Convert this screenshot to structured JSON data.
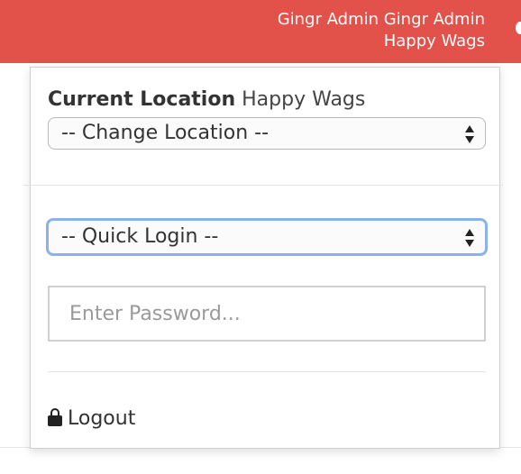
{
  "header": {
    "user_name": "Gingr Admin Gingr Admin",
    "location_name": "Happy Wags",
    "accent_color": "#e2524a"
  },
  "dropdown": {
    "current_location_label": "Current Location",
    "current_location_value": "Happy Wags",
    "change_location_selected": "-- Change Location --",
    "quick_login_selected": "-- Quick Login --",
    "password_placeholder": "Enter Password...",
    "logout_label": "Logout",
    "logout_icon": "lock-icon"
  }
}
